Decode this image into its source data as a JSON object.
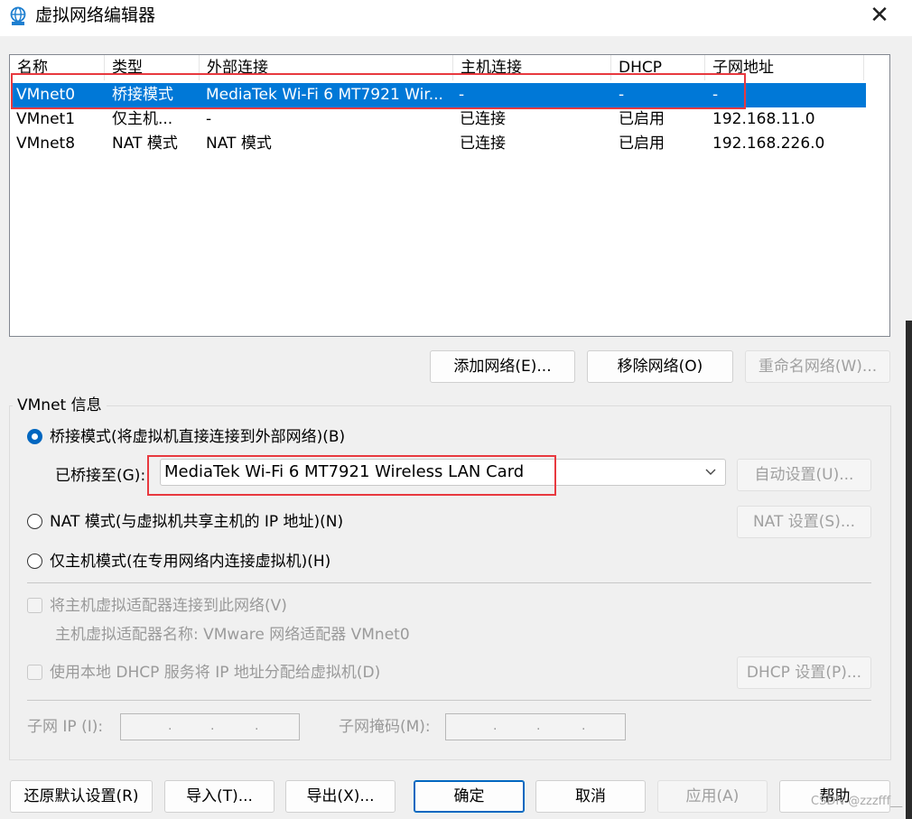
{
  "window": {
    "title": "虚拟网络编辑器",
    "close": "✕"
  },
  "table": {
    "headers": [
      "名称",
      "类型",
      "外部连接",
      "主机连接",
      "DHCP",
      "子网地址"
    ],
    "rows": [
      [
        "VMnet0",
        "桥接模式",
        "MediaTek Wi-Fi 6 MT7921 Wir...",
        "-",
        "-",
        "-"
      ],
      [
        "VMnet1",
        "仅主机...",
        "-",
        "已连接",
        "已启用",
        "192.168.11.0"
      ],
      [
        "VMnet8",
        "NAT 模式",
        "NAT 模式",
        "已连接",
        "已启用",
        "192.168.226.0"
      ]
    ],
    "selected_row": 0
  },
  "list_buttons": {
    "add": "添加网络(E)...",
    "remove": "移除网络(O)",
    "rename": "重命名网络(W)..."
  },
  "vmnet_info": {
    "legend": "VMnet 信息",
    "bridge_radio": "桥接模式(将虚拟机直接连接到外部网络)(B)",
    "bridged_to_label": "已桥接至(G):",
    "bridged_to_value": "MediaTek Wi-Fi 6 MT7921 Wireless LAN Card",
    "auto_settings": "自动设置(U)...",
    "nat_radio": "NAT 模式(与虚拟机共享主机的 IP 地址)(N)",
    "nat_settings": "NAT 设置(S)...",
    "hostonly_radio": "仅主机模式(在专用网络内连接虚拟机)(H)",
    "connect_adapter": "将主机虚拟适配器连接到此网络(V)",
    "adapter_name": "主机虚拟适配器名称: VMware 网络适配器 VMnet0",
    "use_dhcp": "使用本地 DHCP 服务将 IP 地址分配给虚拟机(D)",
    "dhcp_settings": "DHCP 设置(P)...",
    "subnet_ip_label": "子网 IP (I):",
    "subnet_mask_label": "子网掩码(M):"
  },
  "footer": {
    "restore": "还原默认设置(R)",
    "import": "导入(T)...",
    "export": "导出(X)...",
    "ok": "确定",
    "cancel": "取消",
    "apply": "应用(A)",
    "help": "帮助"
  },
  "watermark": "CSDN @zzzfff__",
  "colors": {
    "selection": "#0078d7",
    "highlight_box": "#e8393f",
    "radio_accent": "#0067c0"
  }
}
